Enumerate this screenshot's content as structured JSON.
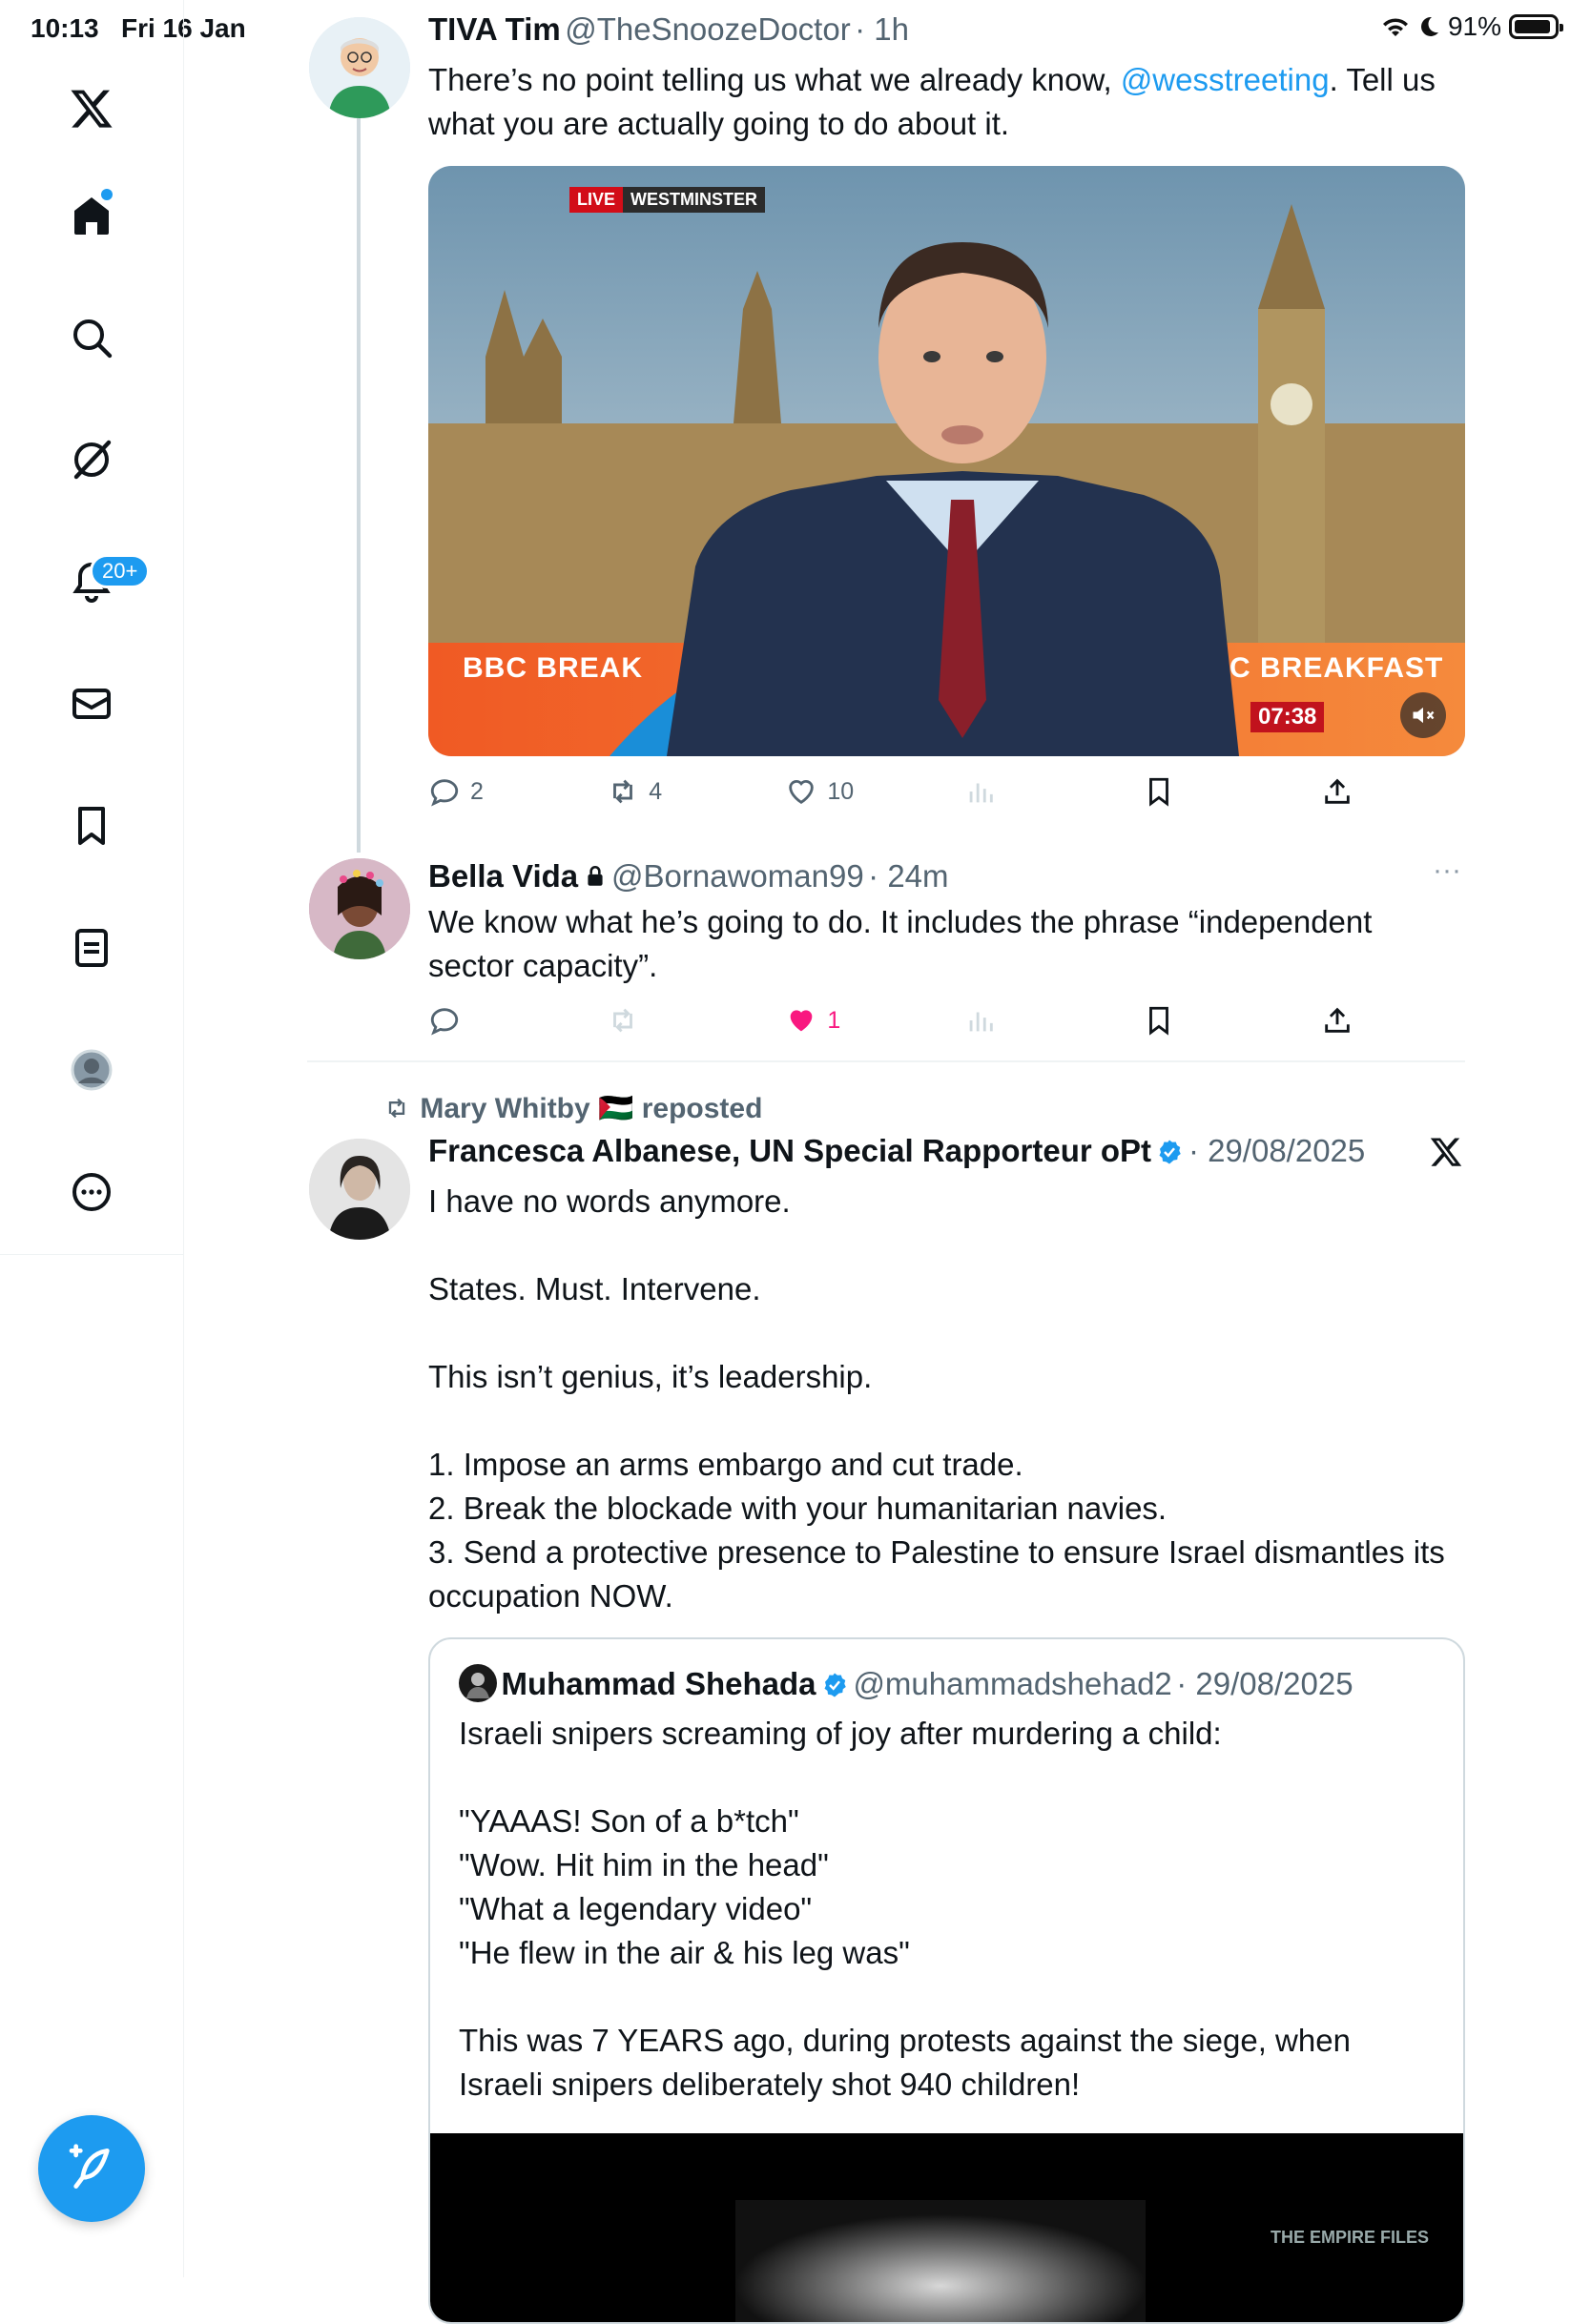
{
  "status_bar": {
    "time": "10:13",
    "date": "Fri 16 Jan",
    "battery": "91%"
  },
  "nav": {
    "notifications_badge": "20+"
  },
  "post1": {
    "display_name": "TIVA Tim",
    "handle": "@TheSnoozeDoctor",
    "time": "· 1h",
    "text_before": "There’s no point telling us what we already know, ",
    "mention": "@wesstreeting",
    "text_after": ". Tell us what you are actually going to do about it.",
    "media": {
      "live_label": "LIVE",
      "location_label": "WESTMINSTER",
      "ticker_left": "BBC BREAK",
      "ticker_right": "C BREAKFAST",
      "clock": "07:38"
    },
    "replies": "2",
    "reposts": "4",
    "likes": "10"
  },
  "post2": {
    "display_name": "Bella Vida",
    "handle": "@Bornawoman99",
    "time": "· 24m",
    "text": "We know what he’s going to do. It includes the phrase “independent sector capacity”.",
    "likes": "1",
    "more": "···"
  },
  "post3": {
    "repost_by": "Mary Whitby 🇵🇸 reposted",
    "display_name": "Francesca Albanese, UN Special Rapporteur oPt",
    "time": "· 29/08/2025",
    "text": "I have no words anymore.\n\nStates. Must. Intervene.\n\nThis isn’t genius, it’s leadership.\n\n1. Impose an arms embargo and cut trade.\n2. Break the blockade with your humanitarian navies.\n3. Send a protective presence to Palestine to ensure Israel dismantles its occupation NOW.",
    "quote": {
      "display_name": "Muhammad Shehada",
      "handle": "@muhammadshehad2",
      "time": "· 29/08/2025",
      "text": "Israeli snipers screaming of joy after murdering a child:\n\n\"YAAAS! Son of a b*tch\"\n\"Wow. Hit him in the head\"\n\"What a legendary video\"\n\"He flew in the air & his leg was\"\n\nThis was 7 YEARS ago, during protests against the siege, when Israeli snipers deliberately shot 940 children!",
      "watermark": "THE EMPIRE FILES"
    }
  },
  "colors": {
    "accent": "#1d9bf0",
    "like": "#f91880",
    "text": "#0f1419",
    "muted": "#536471"
  }
}
